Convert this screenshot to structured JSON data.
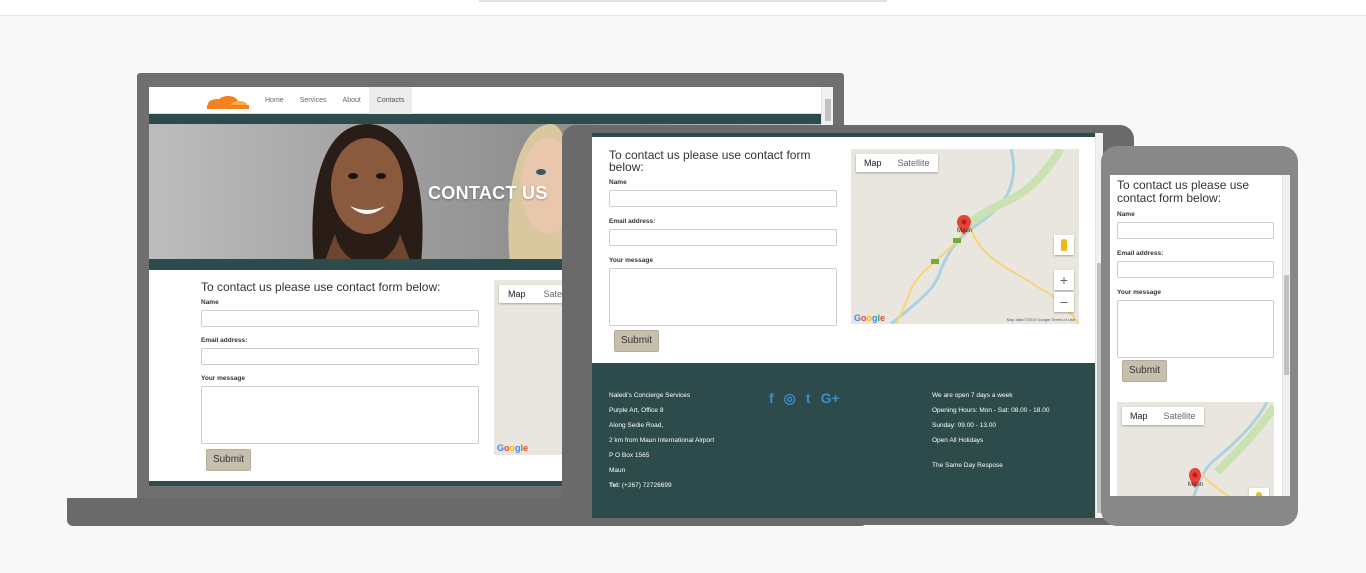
{
  "site": {
    "nav": [
      "Home",
      "Services",
      "About",
      "Contacts"
    ],
    "active_nav": "Contacts",
    "hero_title": "CONTACT US"
  },
  "form": {
    "heading": "To contact us please use contact form below:",
    "name_label": "Name",
    "email_label": "Email address:",
    "message_label": "Your message",
    "submit_label": "Submit"
  },
  "map": {
    "map_tab": "Map",
    "satellite_tab": "Satellite",
    "map_tab_truncated": "Satel",
    "place": "Maun",
    "road": "A3",
    "zoom_in": "+",
    "zoom_out": "−",
    "attribution": "Map data ©2019 Google   Terms of Use",
    "google": [
      "G",
      "o",
      "o",
      "g",
      "l",
      "e"
    ]
  },
  "footer": {
    "address": [
      "Naledi's Concierge Services",
      "Purple Art, Office 8",
      "Along Sedie Road,",
      "2 km from Maun International Airport",
      "P O Box 1565",
      "Maun"
    ],
    "tel_label": "Tel:",
    "tel_value": "(+267) 72726699",
    "social": [
      "f",
      "◎",
      "t",
      "G+"
    ],
    "hours": [
      "We are open 7 days a week",
      "Opening Hours: Mon - Sat: 08.00 - 18.00",
      "Sunday: 09.00 - 13.00",
      "Open All Holidays"
    ],
    "tagline": "The Same Day Respose"
  },
  "colors": {
    "brand_dark": "#2d4b4b",
    "submit_bg": "#c7bfad",
    "social_blue": "#3a8fc9",
    "logo_orange": "#f48120"
  }
}
